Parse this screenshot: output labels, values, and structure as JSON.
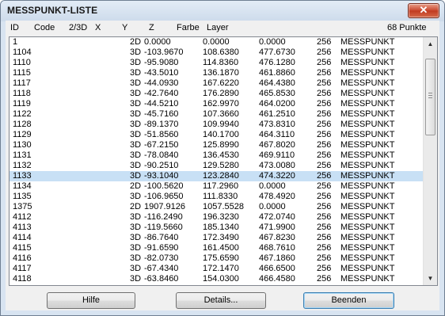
{
  "window": {
    "title": "MESSPUNKT-LISTE",
    "close_label": "✕"
  },
  "header": {
    "id": "ID",
    "code": "Code",
    "dim": "2/3D",
    "x": "X",
    "y": "Y",
    "z": "Z",
    "farbe": "Farbe",
    "layer": "Layer",
    "count": "68 Punkte"
  },
  "rows": [
    {
      "id": "1",
      "dim": "2D",
      "x": "0.0000",
      "y": "0.0000",
      "z": "0.0000",
      "farbe": "256",
      "layer": "MESSPUNKT"
    },
    {
      "id": "1104",
      "dim": "3D",
      "x": "-103.9670",
      "y": "108.6380",
      "z": "477.6730",
      "farbe": "256",
      "layer": "MESSPUNKT"
    },
    {
      "id": "1110",
      "dim": "3D",
      "x": "-95.9080",
      "y": "114.8360",
      "z": "476.1280",
      "farbe": "256",
      "layer": "MESSPUNKT"
    },
    {
      "id": "1115",
      "dim": "3D",
      "x": "-43.5010",
      "y": "136.1870",
      "z": "461.8860",
      "farbe": "256",
      "layer": "MESSPUNKT"
    },
    {
      "id": "1117",
      "dim": "3D",
      "x": "-44.0930",
      "y": "167.6220",
      "z": "464.4380",
      "farbe": "256",
      "layer": "MESSPUNKT"
    },
    {
      "id": "1118",
      "dim": "3D",
      "x": "-42.7640",
      "y": "176.2890",
      "z": "465.8530",
      "farbe": "256",
      "layer": "MESSPUNKT"
    },
    {
      "id": "1119",
      "dim": "3D",
      "x": "-44.5210",
      "y": "162.9970",
      "z": "464.0200",
      "farbe": "256",
      "layer": "MESSPUNKT"
    },
    {
      "id": "1122",
      "dim": "3D",
      "x": "-45.7160",
      "y": "107.3660",
      "z": "461.2510",
      "farbe": "256",
      "layer": "MESSPUNKT"
    },
    {
      "id": "1128",
      "dim": "3D",
      "x": "-89.1370",
      "y": "109.9940",
      "z": "473.8310",
      "farbe": "256",
      "layer": "MESSPUNKT"
    },
    {
      "id": "1129",
      "dim": "3D",
      "x": "-51.8560",
      "y": "140.1700",
      "z": "464.3110",
      "farbe": "256",
      "layer": "MESSPUNKT"
    },
    {
      "id": "1130",
      "dim": "3D",
      "x": "-67.2150",
      "y": "125.8990",
      "z": "467.8020",
      "farbe": "256",
      "layer": "MESSPUNKT"
    },
    {
      "id": "1131",
      "dim": "3D",
      "x": "-78.0840",
      "y": "136.4530",
      "z": "469.9110",
      "farbe": "256",
      "layer": "MESSPUNKT"
    },
    {
      "id": "1132",
      "dim": "3D",
      "x": "-90.2510",
      "y": "129.5280",
      "z": "473.0080",
      "farbe": "256",
      "layer": "MESSPUNKT"
    },
    {
      "id": "1133",
      "dim": "3D",
      "x": "-93.1040",
      "y": "123.2840",
      "z": "474.3220",
      "farbe": "256",
      "layer": "MESSPUNKT",
      "selected": true
    },
    {
      "id": "1134",
      "dim": "2D",
      "x": "-100.5620",
      "y": "117.2960",
      "z": "0.0000",
      "farbe": "256",
      "layer": "MESSPUNKT"
    },
    {
      "id": "1135",
      "dim": "3D",
      "x": "-106.9650",
      "y": "111.8330",
      "z": "478.4920",
      "farbe": "256",
      "layer": "MESSPUNKT"
    },
    {
      "id": "1375",
      "dim": "2D",
      "x": "1907.9126",
      "y": "1057.5528",
      "z": "0.0000",
      "farbe": "256",
      "layer": "MESSPUNKT"
    },
    {
      "id": "4112",
      "dim": "3D",
      "x": "-116.2490",
      "y": "196.3230",
      "z": "472.0740",
      "farbe": "256",
      "layer": "MESSPUNKT"
    },
    {
      "id": "4113",
      "dim": "3D",
      "x": "-119.5660",
      "y": "185.1340",
      "z": "471.9900",
      "farbe": "256",
      "layer": "MESSPUNKT"
    },
    {
      "id": "4114",
      "dim": "3D",
      "x": "-86.7640",
      "y": "172.3490",
      "z": "467.8230",
      "farbe": "256",
      "layer": "MESSPUNKT"
    },
    {
      "id": "4115",
      "dim": "3D",
      "x": "-91.6590",
      "y": "161.4500",
      "z": "468.7610",
      "farbe": "256",
      "layer": "MESSPUNKT"
    },
    {
      "id": "4116",
      "dim": "3D",
      "x": "-82.0730",
      "y": "175.6590",
      "z": "467.1860",
      "farbe": "256",
      "layer": "MESSPUNKT"
    },
    {
      "id": "4117",
      "dim": "3D",
      "x": "-67.4340",
      "y": "172.1470",
      "z": "466.6500",
      "farbe": "256",
      "layer": "MESSPUNKT"
    },
    {
      "id": "4118",
      "dim": "3D",
      "x": "-63.8460",
      "y": "154.0300",
      "z": "466.4580",
      "farbe": "256",
      "layer": "MESSPUNKT"
    }
  ],
  "buttons": {
    "hilfe": "Hilfe",
    "details": "Details...",
    "beenden": "Beenden"
  },
  "icons": {
    "close": "close-icon",
    "up": "scroll-up-arrow-icon",
    "down": "scroll-down-arrow-icon"
  },
  "colors": {
    "selection": "#c8e0f5",
    "close": "#c9462c",
    "frame": "#d8e4f1"
  }
}
